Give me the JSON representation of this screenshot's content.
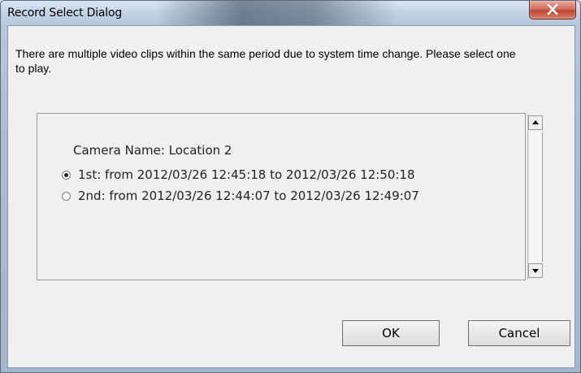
{
  "window": {
    "title": "Record Select Dialog"
  },
  "message": "There are multiple video clips within the same period due to system time change. Please select one to play.",
  "group": {
    "camera_label": "Camera Name: Location 2",
    "options": [
      {
        "label": "1st: from 2012/03/26 12:45:18 to 2012/03/26 12:50:18",
        "selected": true
      },
      {
        "label": "2nd: from 2012/03/26 12:44:07 to 2012/03/26 12:49:07",
        "selected": false
      }
    ]
  },
  "buttons": {
    "ok": "OK",
    "cancel": "Cancel"
  },
  "icons": {
    "close": "close-icon",
    "scroll_up": "scroll-up-arrow-icon",
    "scroll_down": "scroll-down-arrow-icon"
  }
}
